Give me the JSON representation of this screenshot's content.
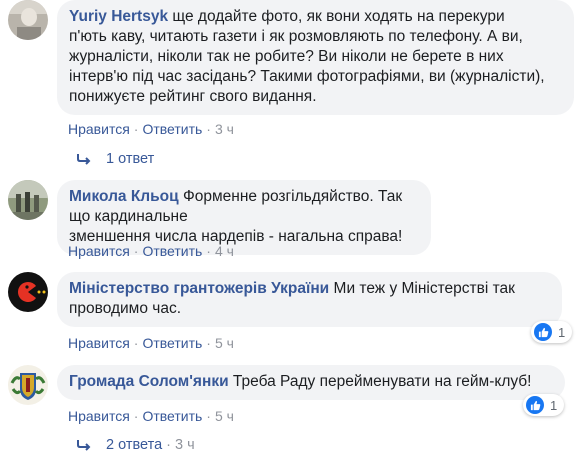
{
  "comments": [
    {
      "author": "Yuriy Hertsyk",
      "text_lines": [
        "ще додайте фото, як вони ходять на перекури",
        "п'ють каву, читають газети і як розмовляють по телефону. А ви,",
        "журналісти, ніколи так не робите? Ви ніколи не берете в них",
        "інтерв'ю під час засідань? Такими фотографіями, ви (журналісти),",
        "понижуєте рейтинг свого видання."
      ],
      "like": "Нравится",
      "reply": "Ответить",
      "time": "3 ч"
    },
    {
      "author": "Микола Кльоц",
      "text_lines": [
        "Форменне розгільдяйство. Так що кардинальне",
        "зменшення числа нардепів - нагальна справа!"
      ],
      "like": "Нравится",
      "reply": "Ответить",
      "time": "4 ч"
    },
    {
      "author": "Міністерство грантожерів України",
      "text_lines": [
        "Ми теж у Міністерстві так",
        "проводимо час."
      ],
      "like": "Нравится",
      "reply": "Ответить",
      "time": "5 ч",
      "reaction_count": "1"
    },
    {
      "author": "Громада Солом'янки",
      "text_lines": [
        "Треба Раду перейменувати на гейм-клуб!"
      ],
      "like": "Нравится",
      "reply": "Ответить",
      "time": "5 ч",
      "reaction_count": "1"
    }
  ],
  "reply_links": {
    "first": {
      "label": "1 ответ"
    },
    "last": {
      "label": "2 ответа",
      "time": "3 ч"
    }
  },
  "icons": {
    "like": "thumbs-up-icon",
    "reply_arrow": "reply-arrow-icon"
  },
  "colors": {
    "link": "#385898",
    "bubble": "#f2f3f5",
    "like_blue": "#1877f2",
    "meta": "#90949c"
  }
}
